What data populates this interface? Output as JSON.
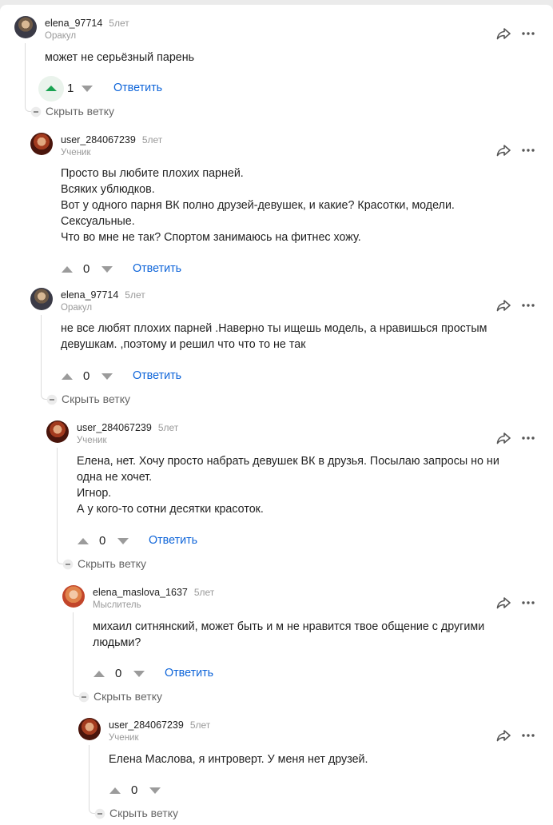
{
  "ui": {
    "reply_label": "Ответить",
    "hide_branch_label": "Скрыть ветку"
  },
  "colors": {
    "accent_link": "#0d64d9",
    "upvote_active": "#1aa352",
    "muted_text": "#999999"
  },
  "comments": [
    {
      "username": "elena_97714",
      "age": "5лет",
      "rank": "Оракул",
      "lines": [
        "может не серьёзный парень"
      ],
      "votes": "1",
      "upvote_active": true
    },
    {
      "username": "user_284067239",
      "age": "5лет",
      "rank": "Ученик",
      "lines": [
        "Просто вы любите плохих парней.",
        "Всяких ублюдков.",
        "Вот у одного парня ВК полно друзей-девушек, и какие? Красотки, модели.",
        "Сексуальные.",
        "Что во мне не так? Спортом занимаюсь на фитнес хожу."
      ],
      "votes": "0",
      "upvote_active": false
    },
    {
      "username": "elena_97714",
      "age": "5лет",
      "rank": "Оракул",
      "lines": [
        "не все любят плохих парней .Наверно ты ищешь модель, а нравишься простым",
        "девушкам. ,поэтому и решил что что то не так"
      ],
      "votes": "0",
      "upvote_active": false
    },
    {
      "username": "user_284067239",
      "age": "5лет",
      "rank": "Ученик",
      "lines": [
        "Елена, нет. Хочу просто набрать девушек ВК в друзья. Посылаю запросы но ни",
        "одна не хочет.",
        "Игнор.",
        "А у кого-то сотни десятки красоток."
      ],
      "votes": "0",
      "upvote_active": false
    },
    {
      "username": "elena_maslova_1637",
      "age": "5лет",
      "rank": "Мыслитель",
      "lines": [
        "михаил ситнянский, может быть и м не нравится твое общение с другими",
        "людьми?"
      ],
      "votes": "0",
      "upvote_active": false
    },
    {
      "username": "user_284067239",
      "age": "5лет",
      "rank": "Ученик",
      "lines": [
        "Елена Маслова, я интроверт. У меня нет друзей."
      ],
      "votes": "0",
      "upvote_active": false
    }
  ]
}
